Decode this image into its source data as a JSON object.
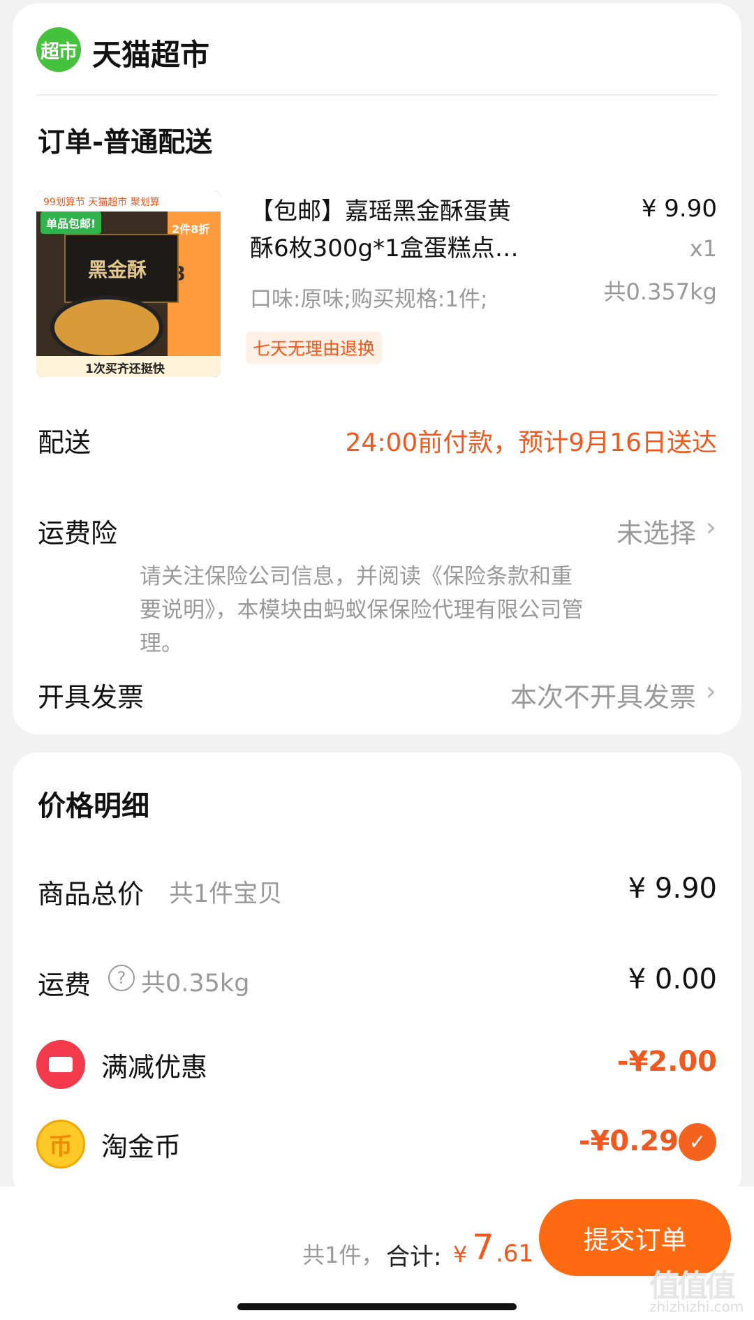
{
  "store": {
    "logo_text": "超市",
    "name": "天猫超市"
  },
  "order": {
    "section_title": "订单-普通配送",
    "product": {
      "title_line1": "【包邮】嘉瑶黑金酥蛋黄",
      "title_line2": "酥6枚300g*1盒蛋糕点…",
      "price": "¥ 9.90",
      "quantity": "x1",
      "weight": "共0.357kg",
      "spec": "口味:原味;购买规格:1件;",
      "return_tag": "七天无理由退换",
      "image_texts": {
        "top": "99划算节 天猫超市 聚划算",
        "badge": "单品包邮!",
        "promo": "2件8折",
        "price_label": "8",
        "box_label": "黑金酥",
        "bottom": "1次买齐还挺快"
      }
    },
    "delivery": {
      "label": "配送",
      "value": "24:00前付款，预计9月16日送达"
    },
    "insurance": {
      "label": "运费险",
      "value": "未选择",
      "note": "请关注保险公司信息，并阅读《保险条款和重要说明》，本模块由蚂蚁保保险代理有限公司管理。"
    },
    "invoice": {
      "label": "开具发票",
      "value": "本次不开具发票"
    }
  },
  "price_details": {
    "title": "价格明细",
    "goods_total": {
      "label": "商品总价",
      "sub": "共1件宝贝",
      "value": "¥ 9.90"
    },
    "shipping": {
      "label": "运费",
      "help_glyph": "?",
      "sub": "共0.35kg",
      "value": "¥ 0.00"
    },
    "discount": {
      "label": "满减优惠",
      "value": "-¥2.00",
      "icon": "ticket-icon",
      "color": "#f23a4c"
    },
    "coins": {
      "label": "淘金币",
      "value": "-¥0.29",
      "icon": "coin-icon",
      "icon_glyph": "币",
      "checked": true
    }
  },
  "bottom_bar": {
    "count_text": "共1件，",
    "total_label": "合计:",
    "currency": "¥",
    "total_int": "7",
    "total_dec": ".61",
    "submit_label": "提交订单",
    "watermark_logo": "值值值",
    "watermark_url": "zhizhizhi.com"
  },
  "colors": {
    "accent": "#f0581e",
    "button": "#ff6a10",
    "store_green": "#45c23d",
    "coin": "#ffc928"
  },
  "icons": {
    "arrow": "chevron-right-icon",
    "check": "check-icon"
  }
}
